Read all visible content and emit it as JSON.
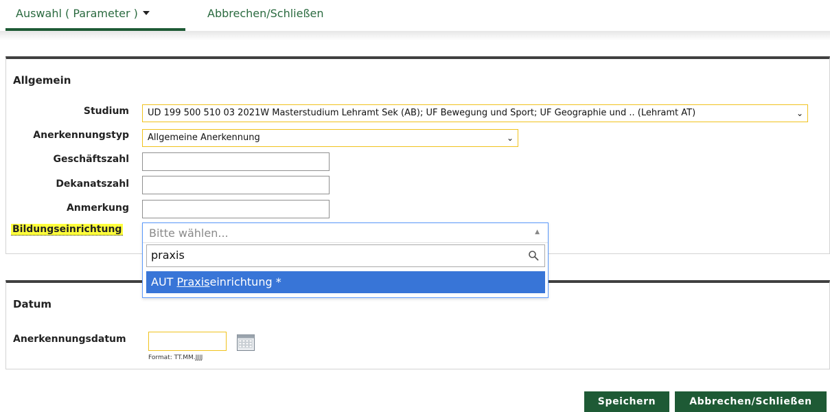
{
  "menu": {
    "auswahl_label": "Auswahl ( Parameter )",
    "abbrechen_label": "Abbrechen/Schließen"
  },
  "allgemein": {
    "title": "Allgemein",
    "studium_label": "Studium",
    "studium_value": "UD 199 500 510 03 2021W Masterstudium Lehramt Sek (AB); UF Bewegung und Sport; UF Geographie und .. (Lehramt AT)",
    "anerkennungstyp_label": "Anerkennungstyp",
    "anerkennungstyp_value": "Allgemeine Anerkennung",
    "geschaeftszahl_label": "Geschäftszahl",
    "dekanatszahl_label": "Dekanatszahl",
    "anmerkung_label": "Anmerkung",
    "bildung_label": "Bildungseinrichtung",
    "bildung_placeholder": "Bitte wählen...",
    "bildung_search": "praxis",
    "bildung_result_prefix": "AUT ",
    "bildung_result_match": "Praxis",
    "bildung_result_suffix": "einrichtung *"
  },
  "datum": {
    "title": "Datum",
    "anerkennungsdatum_label": "Anerkennungsdatum",
    "format_hint": "Format: TT.MM.JJJJ"
  },
  "buttons": {
    "save": "Speichern",
    "cancel": "Abbrechen/Schließen"
  },
  "colors": {
    "brand_green": "#1e5a35",
    "menu_text": "#2a6a3f",
    "field_highlight": "#f0c21c",
    "selection_blue": "#3875d7",
    "label_highlight": "#ffff3c"
  }
}
